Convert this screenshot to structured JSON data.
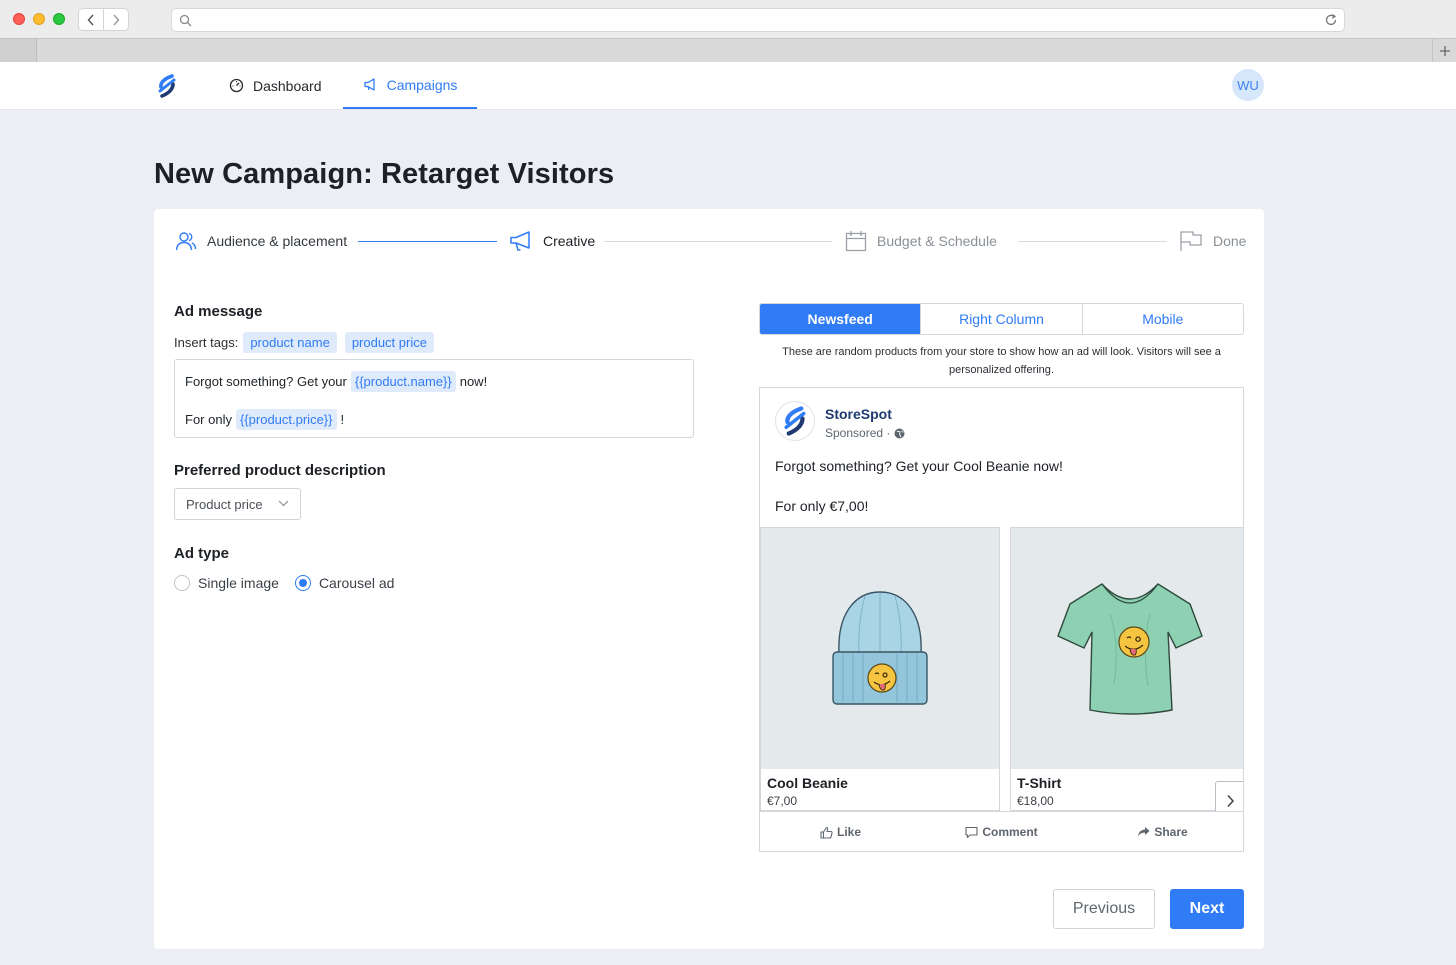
{
  "nav": {
    "items": [
      {
        "label": "Dashboard",
        "icon": "dashboard-gauge-icon"
      },
      {
        "label": "Campaigns",
        "icon": "megaphone-icon",
        "active": true
      }
    ],
    "avatar_initials": "WU"
  },
  "page": {
    "title": "New Campaign: Retarget Visitors"
  },
  "steps": [
    {
      "label": "Audience & placement",
      "icon": "users-icon",
      "state": "completed"
    },
    {
      "label": "Creative",
      "icon": "megaphone-icon",
      "state": "current"
    },
    {
      "label": "Budget & Schedule",
      "icon": "calendar-icon",
      "state": "upcoming"
    },
    {
      "label": "Done",
      "icon": "flag-icon",
      "state": "upcoming"
    }
  ],
  "form": {
    "ad_message_label": "Ad message",
    "insert_tags_label": "Insert tags:",
    "tags": [
      "product name",
      "product price"
    ],
    "message": {
      "line1_before": "Forgot something? Get your",
      "line1_token": "{{product.name}}",
      "line1_after": "now!",
      "line2_before": "For only",
      "line2_token": "{{product.price}}",
      "line2_after": "!"
    },
    "preferred_description_label": "Preferred product description",
    "preferred_description_value": "Product price",
    "ad_type_label": "Ad type",
    "ad_type_options": [
      {
        "label": "Single image",
        "checked": false
      },
      {
        "label": "Carousel ad",
        "checked": true
      }
    ]
  },
  "preview": {
    "tabs": [
      {
        "label": "Newsfeed",
        "active": true
      },
      {
        "label": "Right Column",
        "active": false
      },
      {
        "label": "Mobile",
        "active": false
      }
    ],
    "note": "These are random products from your store to show how an ad will look. Visitors will see a personalized offering.",
    "page_name": "StoreSpot",
    "sponsored": "Sponsored ·",
    "text_line1": "Forgot something? Get your Cool Beanie now!",
    "text_line2": "For only €7,00!",
    "products": [
      {
        "name": "Cool Beanie",
        "price": "€7,00",
        "image": "beanie-illustration"
      },
      {
        "name": "T-Shirt",
        "price": "€18,00",
        "image": "tshirt-illustration"
      }
    ],
    "actions": [
      {
        "label": "Like",
        "icon": "thumbs-up-icon"
      },
      {
        "label": "Comment",
        "icon": "comment-icon"
      },
      {
        "label": "Share",
        "icon": "share-arrow-icon"
      }
    ]
  },
  "footer": {
    "previous_label": "Previous",
    "next_label": "Next"
  },
  "colors": {
    "accent": "#2f7cf6",
    "page_background": "#ebeef2",
    "chip_background": "#dfeafb"
  }
}
